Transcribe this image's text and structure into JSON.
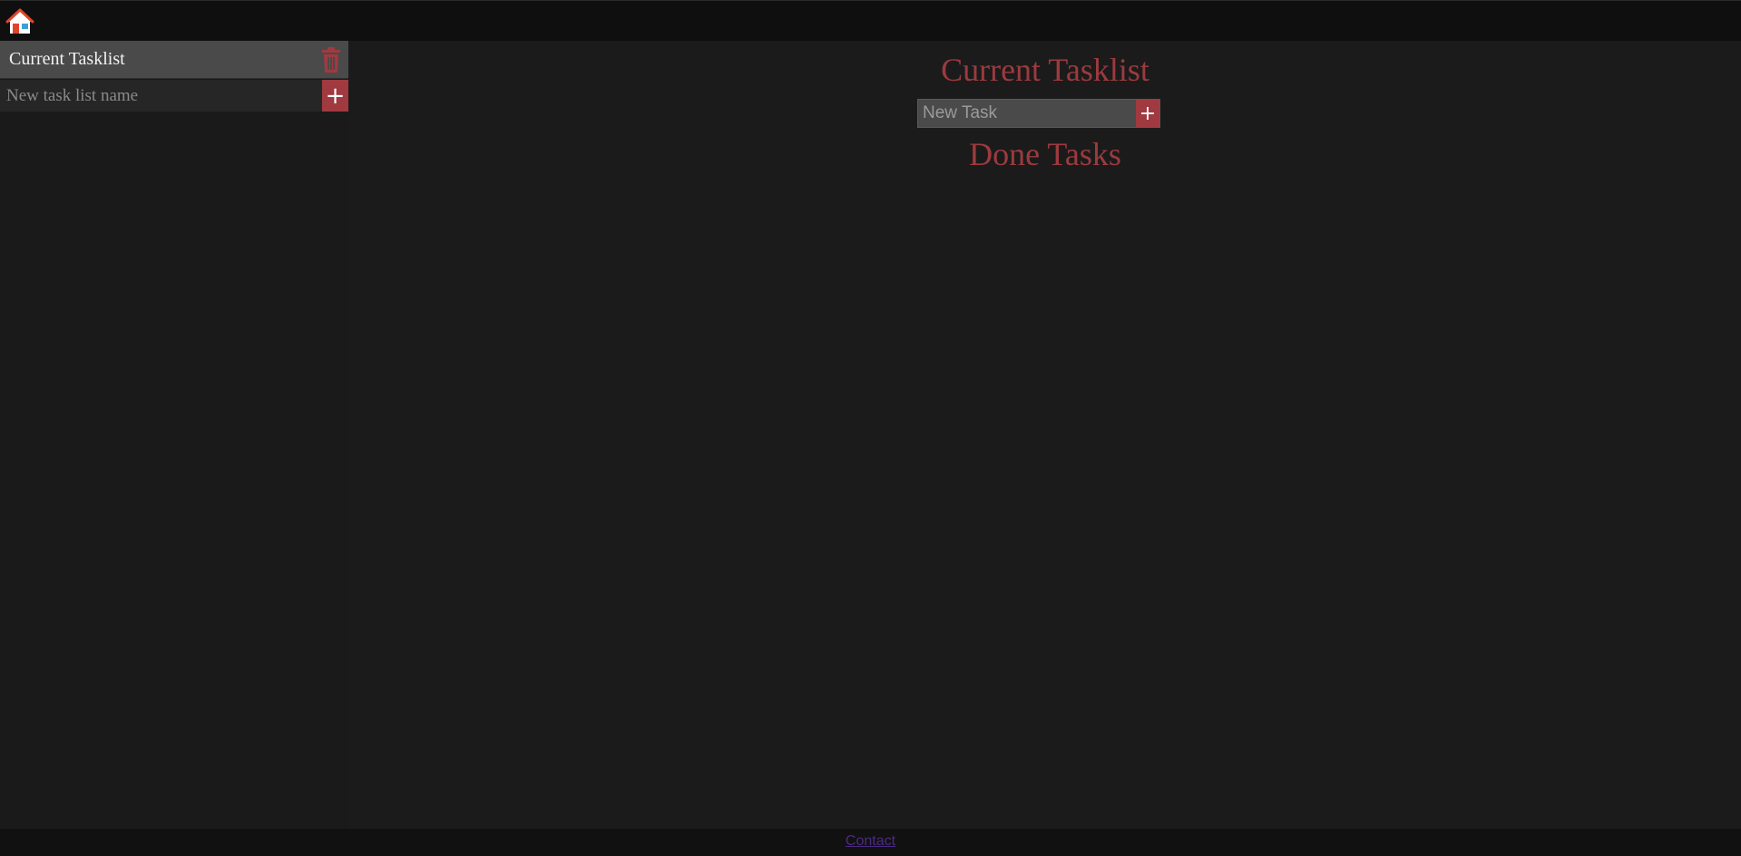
{
  "header": {
    "home_icon": "home-icon"
  },
  "sidebar": {
    "tasklists": [
      {
        "label": "Current Tasklist",
        "delete_icon": "trash-icon"
      }
    ],
    "new_list": {
      "placeholder": "New task list name",
      "value": "",
      "add_label": "+"
    }
  },
  "main": {
    "title": "Current Tasklist",
    "new_task": {
      "placeholder": "New Task",
      "value": "",
      "add_label": "+"
    },
    "done_title": "Done Tasks"
  },
  "footer": {
    "contact_label": "Contact"
  },
  "colors": {
    "accent": "#a03a40",
    "heading": "#9c3a3e",
    "background": "#1b1b1b",
    "topbar": "#0f0f0f",
    "link": "#4b2a82"
  }
}
